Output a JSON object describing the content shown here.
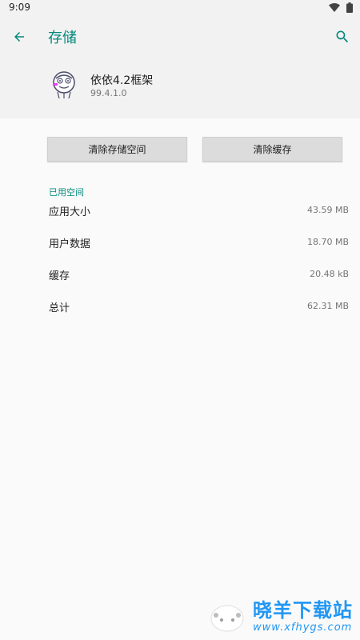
{
  "status_bar": {
    "time": "9:09"
  },
  "toolbar": {
    "title": "存储"
  },
  "app": {
    "name": "依依4.2框架",
    "version": "99.4.1.0"
  },
  "buttons": {
    "clear_storage": "清除存储空间",
    "clear_cache": "清除缓存"
  },
  "section": {
    "header": "已用空间",
    "rows": [
      {
        "label": "应用大小",
        "value": "43.59 MB"
      },
      {
        "label": "用户数据",
        "value": "18.70 MB"
      },
      {
        "label": "缓存",
        "value": "20.48 kB"
      },
      {
        "label": "总计",
        "value": "62.31 MB"
      }
    ]
  },
  "watermark": {
    "name": "晓羊下载站",
    "url": "www.xfhygs.com"
  },
  "colors": {
    "accent": "#00897b",
    "watermark": "#2196f3",
    "background": "#fafafa",
    "header_bg": "#f2f2f2"
  },
  "icons": {
    "back": "arrow-back-icon",
    "search": "search-icon",
    "wifi": "wifi-icon",
    "battery": "battery-icon"
  }
}
